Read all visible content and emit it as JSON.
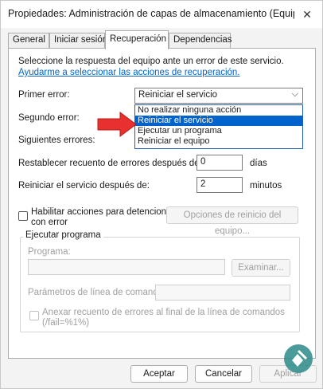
{
  "window": {
    "title": "Propiedades: Administración de capas de almacenamiento (Equipo..."
  },
  "tabs": [
    "General",
    "Iniciar sesión",
    "Recuperación",
    "Dependencias"
  ],
  "recovery": {
    "intro": "Seleccione la respuesta del equipo ante un error de este servicio.",
    "help_link": "Ayudarme a seleccionar las acciones de recuperación.",
    "first_failure_label": "Primer error:",
    "first_failure_value": "Reiniciar el servicio",
    "second_failure_label": "Segundo error:",
    "subsequent_failures_label": "Siguientes errores:",
    "dropdown_options": [
      "No realizar ninguna acción",
      "Reiniciar el servicio",
      "Ejecutar un programa",
      "Reiniciar el equipo"
    ],
    "reset_label": "Restablecer recuento de errores después de:",
    "reset_value": "0",
    "reset_unit": "días",
    "restart_label": "Reiniciar el servicio después de:",
    "restart_value": "2",
    "restart_unit": "minutos",
    "enable_actions_line1": "Habilitar acciones para detenciones",
    "enable_actions_line2": "con error",
    "restart_options_button": "Opciones de reinicio del equipo...",
    "run_program_group": "Ejecutar programa",
    "program_label": "Programa:",
    "browse_button": "Examinar...",
    "params_label": "Parámetros de línea de comandos:",
    "append_line1": "Anexar recuento de errores al final de la línea de comandos",
    "append_line2": "(/fail=%1%)"
  },
  "buttons": {
    "ok": "Aceptar",
    "cancel": "Cancelar",
    "apply": "Aplicar"
  },
  "colors": {
    "accent": "#0063cc",
    "link": "#0066cc",
    "arrow": "#e8302e"
  },
  "icons": {
    "close": "close-icon",
    "chevron": "chevron-down-icon",
    "arrow": "red-arrow-icon",
    "logo": "watermark-logo-icon"
  }
}
